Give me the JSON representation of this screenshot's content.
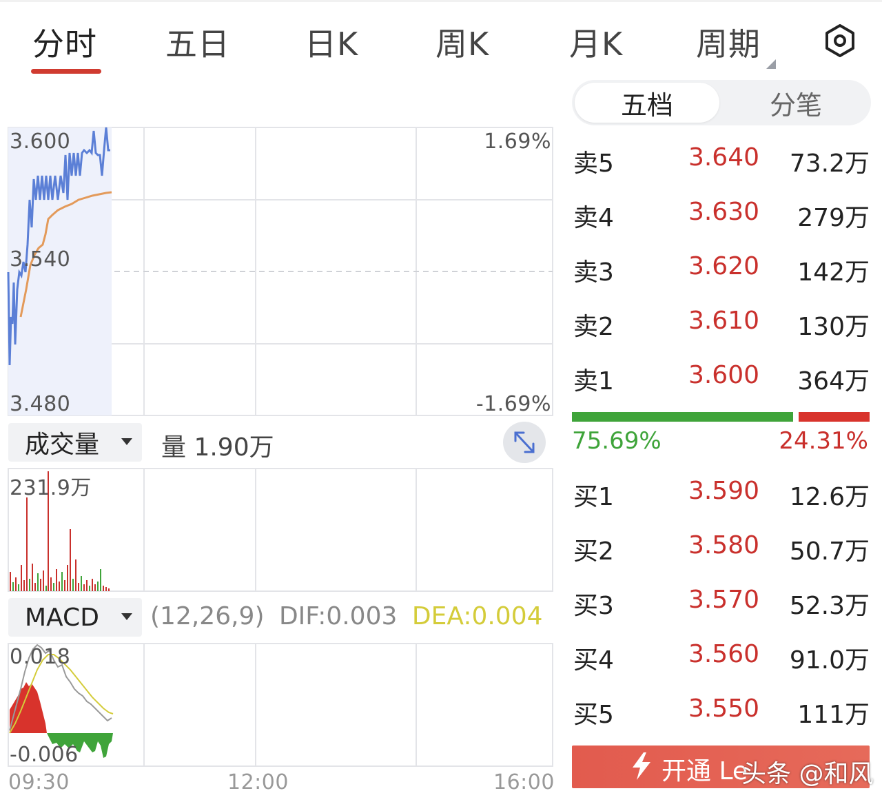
{
  "tabs": [
    {
      "label": "分时",
      "active": true
    },
    {
      "label": "五日",
      "active": false
    },
    {
      "label": "日K",
      "active": false
    },
    {
      "label": "周K",
      "active": false
    },
    {
      "label": "月K",
      "active": false
    },
    {
      "label": "周期",
      "active": false
    }
  ],
  "settings_icon": "hexagon-gear-icon",
  "price_chart": {
    "y_labels": {
      "top": "3.600",
      "mid": "3.540",
      "bottom": "3.480"
    },
    "pct_labels": {
      "top": "1.69%",
      "bottom": "-1.69%"
    },
    "colors": {
      "price_line": "#5b7fd6",
      "avg_line": "#e39a5a",
      "fill": "#eef1fb"
    }
  },
  "volume_panel": {
    "selector_label": "成交量",
    "volume_text": "量 1.90万",
    "max_label": "231.9万",
    "expand_icon": "expand-arrows-icon"
  },
  "macd_panel": {
    "selector_label": "MACD",
    "params": "(12,26,9)",
    "dif": "DIF:0.003",
    "dea": "DEA:0.004",
    "macd_cut": "M",
    "y_top": "0.018",
    "y_bottom": "-0.006"
  },
  "time_axis": [
    "09:30",
    "12:00",
    "16:00"
  ],
  "order_book": {
    "tab_on": "五档",
    "tab_off": "分笔",
    "asks": [
      {
        "label": "卖5",
        "price": "3.640",
        "volume": "73.2万"
      },
      {
        "label": "卖4",
        "price": "3.630",
        "volume": "279万"
      },
      {
        "label": "卖3",
        "price": "3.620",
        "volume": "142万"
      },
      {
        "label": "卖2",
        "price": "3.610",
        "volume": "130万"
      },
      {
        "label": "卖1",
        "price": "3.600",
        "volume": "364万"
      }
    ],
    "bids": [
      {
        "label": "买1",
        "price": "3.590",
        "volume": "12.6万"
      },
      {
        "label": "买2",
        "price": "3.580",
        "volume": "50.7万"
      },
      {
        "label": "买3",
        "price": "3.570",
        "volume": "52.3万"
      },
      {
        "label": "买4",
        "price": "3.560",
        "volume": "91.0万"
      },
      {
        "label": "买5",
        "price": "3.550",
        "volume": "111万"
      }
    ],
    "buy_ratio": "75.69%",
    "sell_ratio": "24.31%",
    "buy_fraction": 0.7569
  },
  "banner": {
    "text": "开通 Le",
    "icon": "lightning-icon"
  },
  "watermark": "头条 @和风"
}
